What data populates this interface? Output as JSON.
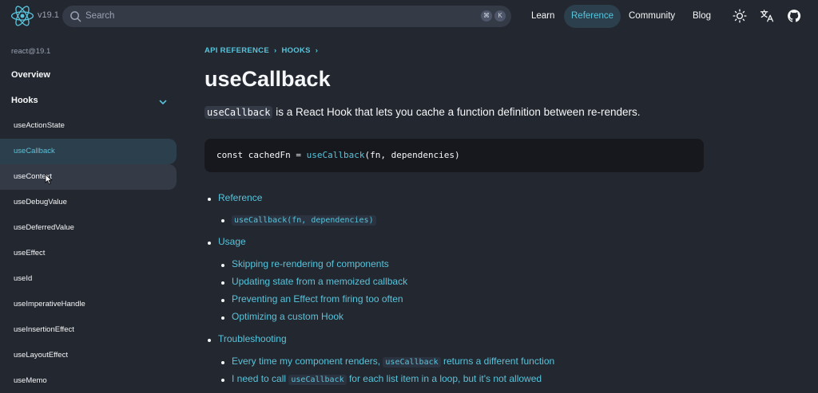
{
  "header": {
    "version": "v19.1",
    "search_placeholder": "Search",
    "shortcut_keys": [
      "⌘",
      "K"
    ],
    "nav": [
      {
        "label": "Learn",
        "active": false
      },
      {
        "label": "Reference",
        "active": true
      },
      {
        "label": "Community",
        "active": false
      },
      {
        "label": "Blog",
        "active": false
      }
    ],
    "icons": [
      "theme-toggle-icon",
      "translate-icon",
      "github-icon"
    ]
  },
  "sidebar": {
    "version": "react@19.1",
    "overview": "Overview",
    "hooks_heading": "Hooks",
    "items": [
      {
        "label": "useActionState",
        "state": "normal"
      },
      {
        "label": "useCallback",
        "state": "active"
      },
      {
        "label": "useContext",
        "state": "hover"
      },
      {
        "label": "useDebugValue",
        "state": "normal"
      },
      {
        "label": "useDeferredValue",
        "state": "normal"
      },
      {
        "label": "useEffect",
        "state": "normal"
      },
      {
        "label": "useId",
        "state": "normal"
      },
      {
        "label": "useImperativeHandle",
        "state": "normal"
      },
      {
        "label": "useInsertionEffect",
        "state": "normal"
      },
      {
        "label": "useLayoutEffect",
        "state": "normal"
      },
      {
        "label": "useMemo",
        "state": "normal"
      }
    ]
  },
  "main": {
    "breadcrumbs": [
      "API REFERENCE",
      "HOOKS"
    ],
    "title": "useCallback",
    "intro_code": "useCallback",
    "intro_text": " is a React Hook that lets you cache a function definition between re-renders.",
    "code": {
      "kw": "const",
      "var": " cachedFn = ",
      "fn": "useCallback",
      "args": "(fn, dependencies)"
    },
    "toc": {
      "reference": "Reference",
      "reference_sub": "useCallback(fn, dependencies)",
      "usage": "Usage",
      "usage_items": [
        "Skipping re-rendering of components",
        "Updating state from a memoized callback",
        "Preventing an Effect from firing too often",
        "Optimizing a custom Hook"
      ],
      "troubleshooting": "Troubleshooting",
      "trouble_1_pre": "Every time my component renders, ",
      "trouble_1_code": "useCallback",
      "trouble_1_post": " returns a different function",
      "trouble_2_pre": "I need to call ",
      "trouble_2_code": "useCallback",
      "trouble_2_post": " for each list item in a loop, but it's not allowed"
    }
  },
  "colors": {
    "background": "#23272f",
    "accent": "#58c4dc",
    "text": "#f6f7f9",
    "muted": "#99a1b3"
  }
}
